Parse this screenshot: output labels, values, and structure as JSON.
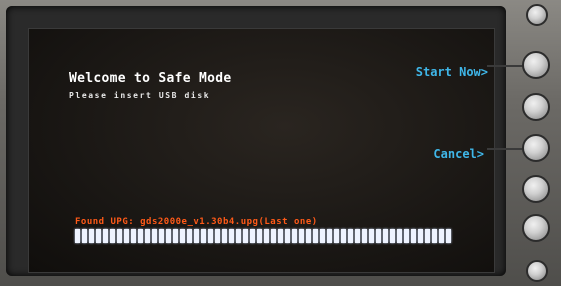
{
  "screen": {
    "title": "Welcome to Safe Mode",
    "subtitle": "Please insert USB disk",
    "status_line": "Found UPG: gds2000e_v1.30b4.upg(Last one)"
  },
  "softkeys": {
    "start_label": "Start Now>",
    "cancel_label": "Cancel>"
  },
  "progress": {
    "fraction": 1.0
  },
  "colors": {
    "softkey": "#3fb6e8",
    "status": "#ff5a18",
    "screen_bg": "#1a1714"
  },
  "icons": [
    "round-knob-button"
  ]
}
